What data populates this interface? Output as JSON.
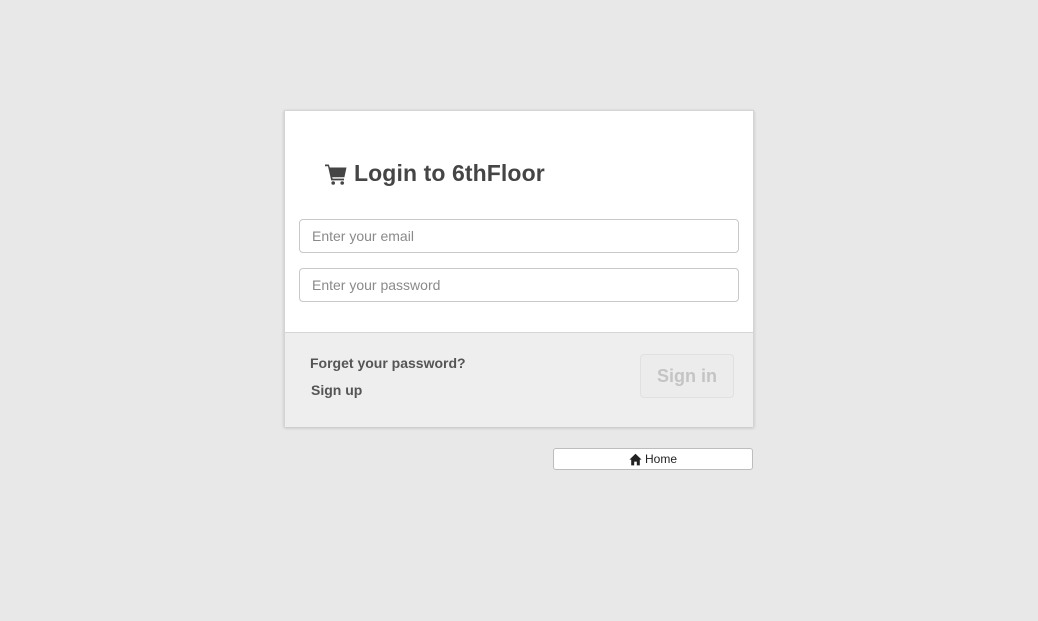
{
  "header": {
    "icon": "shopping-cart-icon",
    "title": "Login to 6thFloor"
  },
  "form": {
    "email_placeholder": "Enter your email",
    "email_value": "",
    "password_placeholder": "Enter your password",
    "password_value": ""
  },
  "footer": {
    "forgot_label": "Forget your password?",
    "signup_label": "Sign up",
    "signin_label": "Sign in"
  },
  "home_button": {
    "icon": "home-icon",
    "label": "Home"
  },
  "colors": {
    "page_background": "#e8e8e8",
    "card_background": "#ffffff",
    "footer_background": "#eeeeee",
    "title_color": "#454545",
    "signin_text_disabled": "#c4c4c4"
  }
}
